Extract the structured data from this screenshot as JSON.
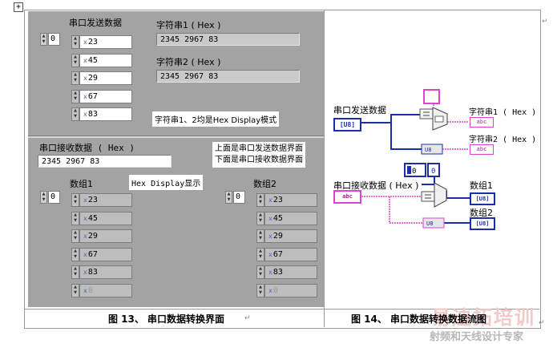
{
  "ui_panel": {
    "send_label": "串口发送数据",
    "send_index": "0",
    "send_values": [
      "23",
      "45",
      "29",
      "67",
      "83"
    ],
    "str1_label": "字符串1 ( Hex )",
    "str1_value": "2345 2967 83",
    "str2_label": "字符串2 ( Hex )",
    "str2_value": "2345 2967 83",
    "note_hex_mode": "字符串1、2均是Hex Display模式",
    "recv_label": "串口接收数据 ( Hex )",
    "recv_value": "2345 2967 83",
    "note_above_below_1": "上面是串口发送数据界面",
    "note_above_below_2": "下面是串口接收数据界面",
    "note_hex_display": "Hex Display显示",
    "arr1_label": "数组1",
    "arr1_index": "0",
    "arr1_values": [
      "23",
      "45",
      "29",
      "67",
      "83",
      "0"
    ],
    "arr2_label": "数组2",
    "arr2_index": "0",
    "arr2_values": [
      "23",
      "45",
      "29",
      "67",
      "83",
      "0"
    ]
  },
  "diagram": {
    "send_label": "串口发送数据",
    "send_term": "[U8]",
    "out1_label": "字符串1 ( Hex )",
    "out2_label": "字符串2 ( Hex )",
    "str_term": "abc",
    "recv_label": "串口接收数据 ( Hex )",
    "arr1_label": "数组1",
    "arr2_label": "数组2",
    "arr_term": "[U8]",
    "const_value": "0",
    "u8_tag": "U8"
  },
  "captions": {
    "fig13": "图 13、 串口数据转换界面",
    "fig14": "图 14、 串口数据转换数据流图"
  },
  "watermark": {
    "line1": "易迪拓培训",
    "line2": "射频和天线设计专家"
  },
  "colors": {
    "u8_wire": "#1c2fa8",
    "string_wire": "#dd44cc",
    "panel_bg": "#a3a3a3"
  }
}
